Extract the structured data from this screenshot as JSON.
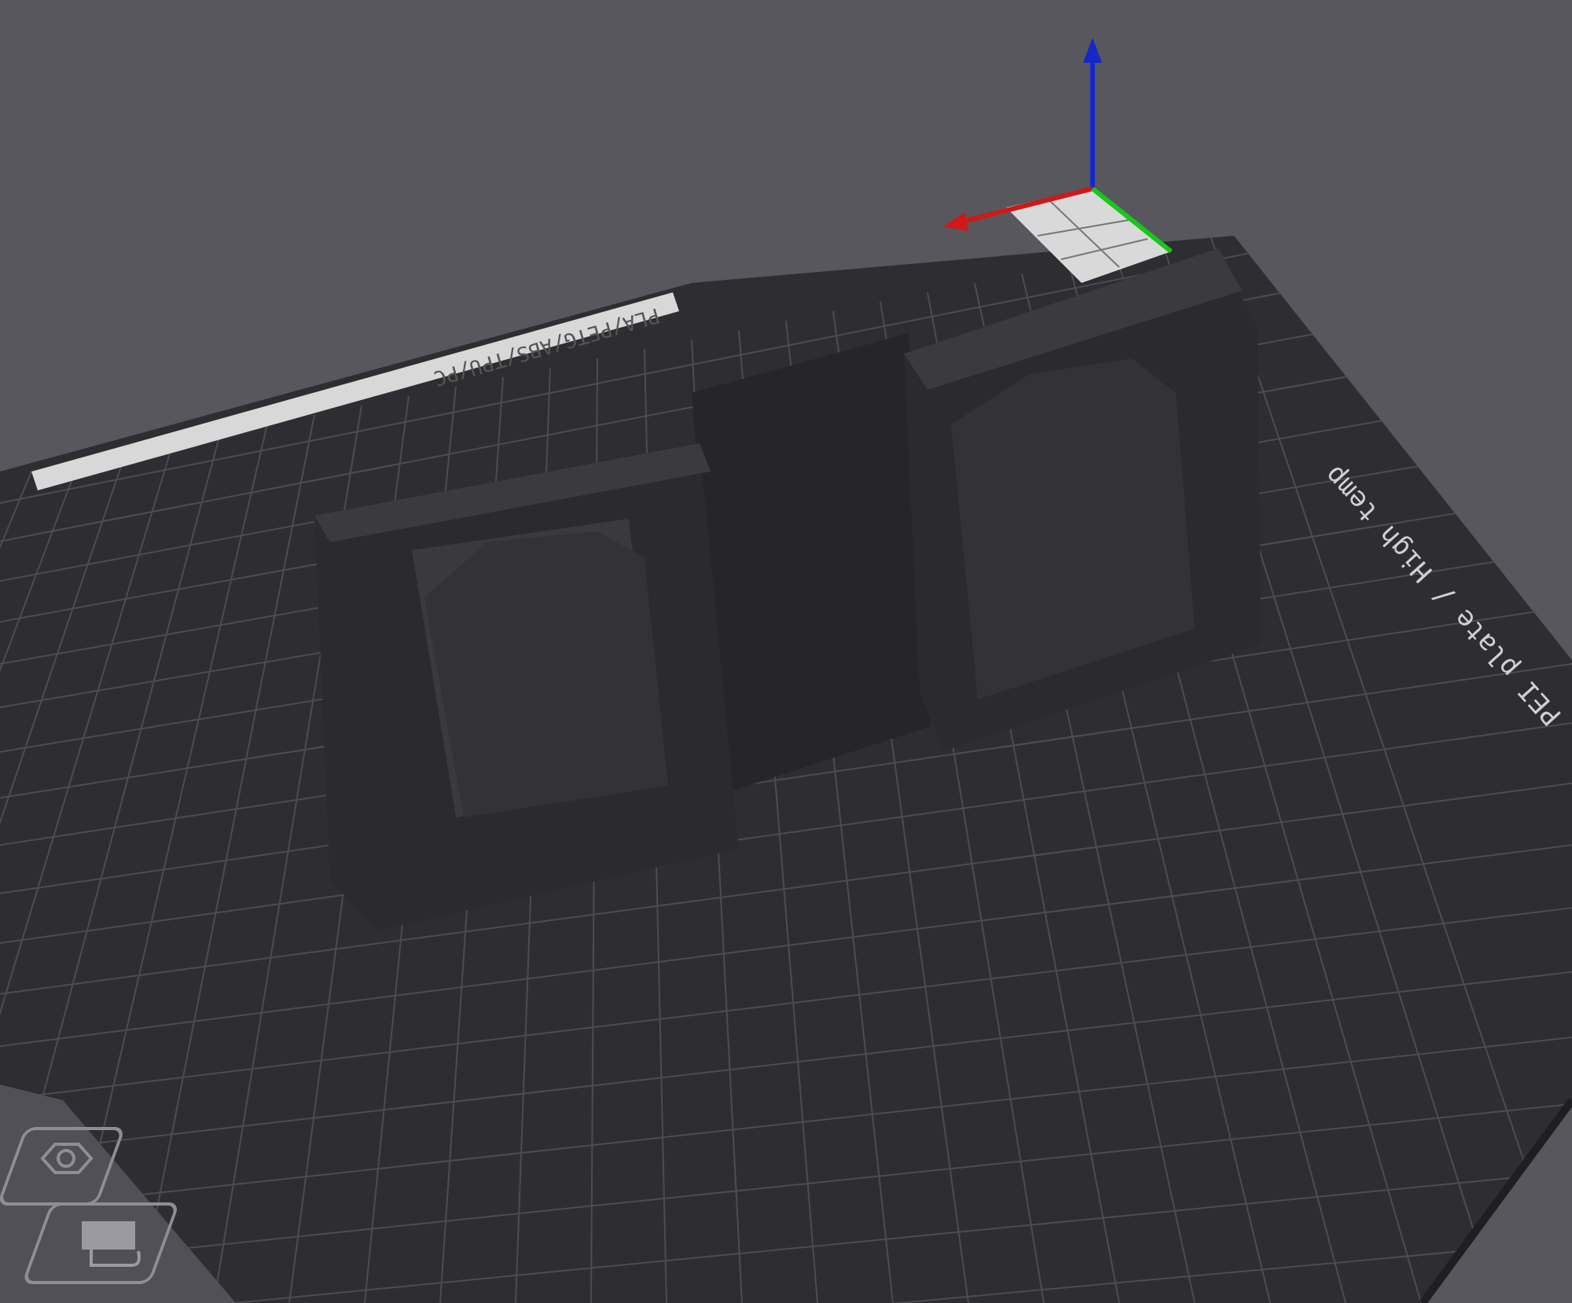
{
  "viewport": {
    "bed_labels": [
      {
        "text": "PLA/PETG/ABS/TPU/PC",
        "kind": "strip"
      },
      {
        "text": "PEI plate / High temp",
        "kind": "plain"
      }
    ]
  }
}
